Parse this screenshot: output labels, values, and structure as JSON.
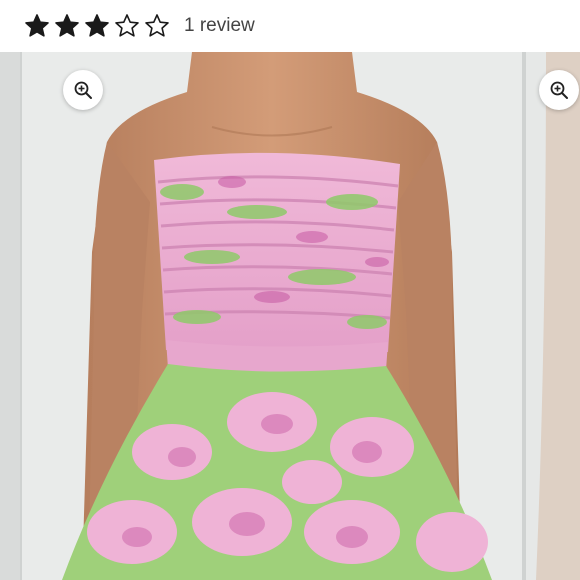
{
  "rating": {
    "stars": [
      {
        "icon": "star-filled-icon",
        "filled": true
      },
      {
        "icon": "star-filled-icon",
        "filled": true
      },
      {
        "icon": "star-filled-icon",
        "filled": true
      },
      {
        "icon": "star-outline-icon",
        "filled": false
      },
      {
        "icon": "star-outline-icon",
        "filled": false
      }
    ],
    "value": 3,
    "max": 5,
    "count_label": "1 review"
  },
  "gallery": {
    "main_zoom_icon": "zoom-in-icon",
    "next_zoom_icon": "zoom-in-icon"
  },
  "colors": {
    "star": "#1a1a1a",
    "dress_pink": "#e7a3cf",
    "dress_green": "#8fca6a",
    "skin": "#c98e6a",
    "background": "#e9ebea"
  }
}
